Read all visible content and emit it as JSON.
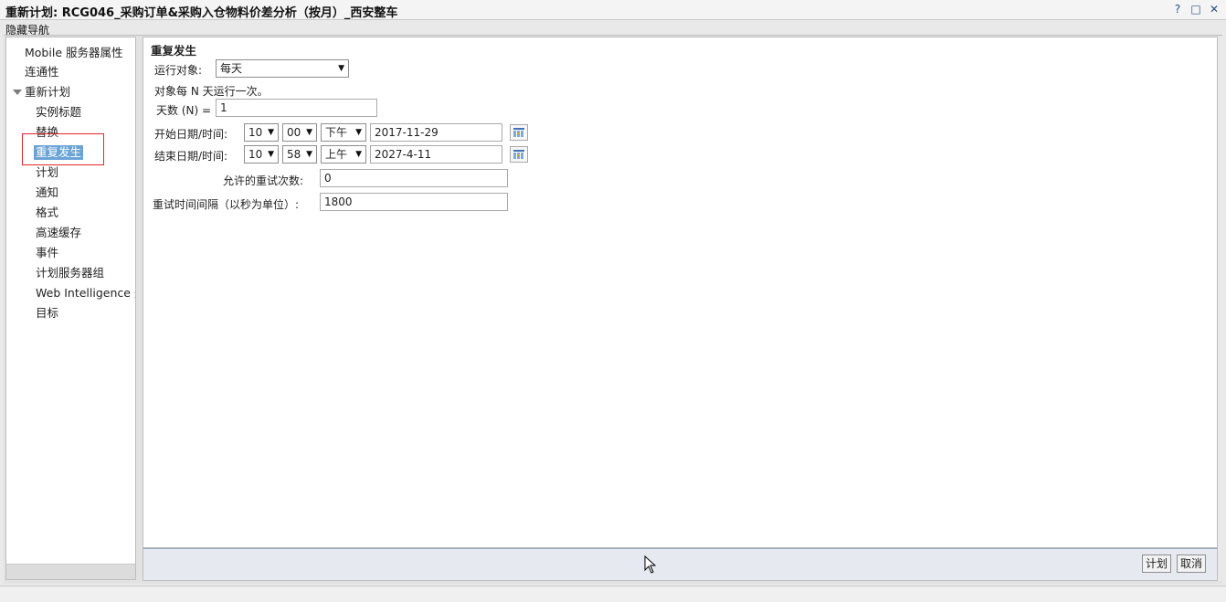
{
  "window": {
    "title": "重新计划: RCG046_采购订单&采购入仓物料价差分析（按月）_西安整车",
    "controls": {
      "help": "?",
      "maximize": "□",
      "close": "✕"
    }
  },
  "hide_nav_label": "隐藏导航",
  "sidebar": {
    "items": [
      {
        "label": "Mobile 服务器属性"
      },
      {
        "label": "连通性"
      },
      {
        "label": "重新计划"
      },
      {
        "label": "实例标题"
      },
      {
        "label": "替换"
      },
      {
        "label": "重复发生"
      },
      {
        "label": "计划"
      },
      {
        "label": "通知"
      },
      {
        "label": "格式"
      },
      {
        "label": "高速缓存"
      },
      {
        "label": "事件"
      },
      {
        "label": "计划服务器组"
      },
      {
        "label": "Web Intelligence 处"
      },
      {
        "label": "目标"
      }
    ],
    "selected": "重复发生"
  },
  "form": {
    "heading": "重复发生",
    "run_object_label": "运行对象:",
    "run_object_value": "每天",
    "description": "对象每 N 天运行一次。",
    "days_label": "天数 (N) =",
    "days_value": "1",
    "start_label": "开始日期/时间:",
    "start_hour": "10",
    "start_minute": "00",
    "start_ampm": "下午",
    "start_date": "2017-11-29",
    "end_label": "结束日期/时间:",
    "end_hour": "10",
    "end_minute": "58",
    "end_ampm": "上午",
    "end_date": "2027-4-11",
    "retries_label": "允许的重试次数:",
    "retries_value": "0",
    "retry_interval_label": "重试时间间隔（以秒为单位）:",
    "retry_interval_value": "1800"
  },
  "footer": {
    "schedule_button": "计划",
    "cancel_button": "取消"
  },
  "icons": {
    "dropdown": "chevron-down-icon",
    "calendar": "calendar-icon",
    "pointer": "mouse-cursor-icon"
  },
  "colors": {
    "selection": "#6aa3d6",
    "highlight_box": "#e0282e"
  }
}
